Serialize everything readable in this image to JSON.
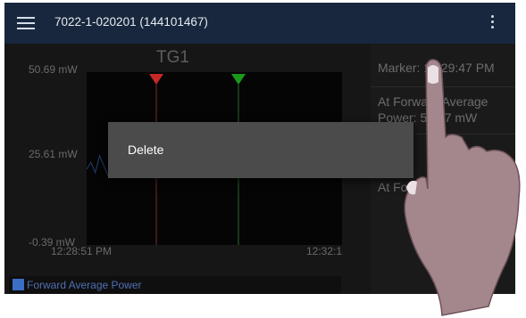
{
  "appbar": {
    "title": "7022-1-020201 (144101467)",
    "menu_icon": "hamburger-menu-icon",
    "overflow_icon": "more-vert-icon"
  },
  "chart": {
    "title": "TG1",
    "y_labels": [
      "50.69 mW",
      "25.61 mW",
      "-0.39 mW"
    ],
    "x_labels": [
      "12:28:51 PM",
      "12:32:1"
    ],
    "legend_label": "Forward Average Power",
    "colors": {
      "series": "#3b6fc6",
      "marker_a": "#c62828",
      "marker_b": "#1a9a1a"
    }
  },
  "chart_data": {
    "type": "line",
    "title": "TG1",
    "xlabel": "",
    "ylabel": "",
    "x_ticks": [
      "12:28:51 PM",
      "12:32:1"
    ],
    "y_ticks": [
      50.69,
      25.61,
      -0.39
    ],
    "ylim": [
      -0.39,
      50.69
    ],
    "grid": false,
    "legend_position": "bottom-left",
    "series": [
      {
        "name": "Forward Average Power",
        "values": [
          22,
          24,
          21,
          26,
          23,
          20,
          25,
          22,
          27,
          23,
          21,
          24,
          20,
          26,
          22,
          25,
          21,
          23,
          28,
          22,
          24,
          20,
          25,
          23,
          21,
          26,
          24,
          22,
          25,
          20,
          27,
          23,
          21,
          24,
          22,
          26,
          23,
          25,
          21,
          24,
          22,
          20,
          25,
          23,
          26,
          22,
          24,
          21,
          23,
          25,
          22,
          24,
          21,
          26,
          23,
          22,
          25,
          24,
          21,
          23
        ]
      }
    ]
  },
  "side_panel": {
    "marker_text": "Marker: 12:29:47 PM",
    "fwd_avg_text": "At Forward Average Power: 57.07 mW",
    "fwd_text": "At Forward Power"
  },
  "dialog": {
    "delete_label": "Delete"
  }
}
